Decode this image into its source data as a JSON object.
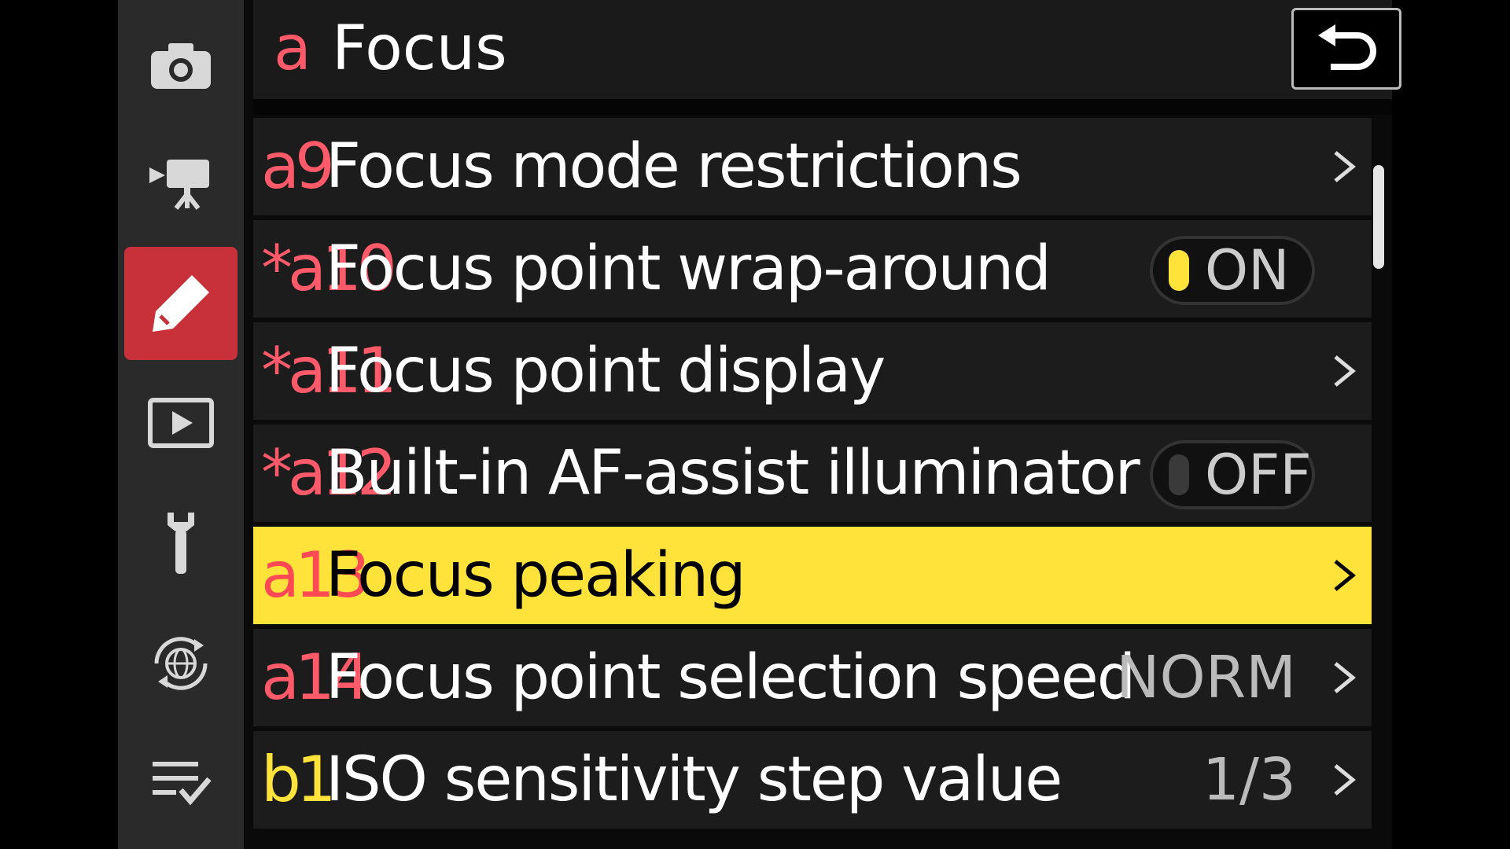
{
  "sidebar": {
    "items": [
      {
        "icon": "camera-icon",
        "active": false
      },
      {
        "icon": "video-camera-icon",
        "active": false
      },
      {
        "icon": "pencil-icon",
        "active": true
      },
      {
        "icon": "playback-icon",
        "active": false
      },
      {
        "icon": "wrench-icon",
        "active": false
      },
      {
        "icon": "network-globe-icon",
        "active": false
      },
      {
        "icon": "my-menu-icon",
        "active": false
      }
    ]
  },
  "header": {
    "prefix": "a",
    "title": "Focus",
    "back_icon": "back-arrow-icon"
  },
  "colors": {
    "accent_red": "#c8303a",
    "code_red": "#ff5a6a",
    "highlight_yellow": "#ffe33a",
    "toggle_on": "#ffe33a",
    "toggle_off": "#3a3a3a"
  },
  "menu": {
    "items": [
      {
        "code": "a9",
        "label": "Focus mode restrictions",
        "value": "",
        "control": "chevron"
      },
      {
        "code": "*a10",
        "label": "Focus point wrap-around",
        "value": "ON",
        "control": "toggle-on"
      },
      {
        "code": "*a11",
        "label": "Focus point display",
        "value": "",
        "control": "chevron"
      },
      {
        "code": "*a12",
        "label": "Built-in AF-assist illuminator",
        "value": "OFF",
        "control": "toggle-off"
      },
      {
        "code": "a13",
        "label": "Focus peaking",
        "value": "",
        "control": "chevron",
        "selected": true
      },
      {
        "code": "a14",
        "label": "Focus point selection speed",
        "value": "NORM",
        "control": "chevron"
      },
      {
        "code": "b1",
        "label": "ISO sensitivity step value",
        "value": "1/3",
        "control": "chevron"
      }
    ]
  }
}
